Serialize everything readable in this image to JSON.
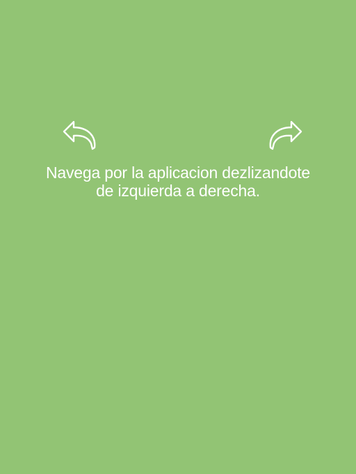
{
  "screen": {
    "background_color": "#92c474",
    "text_color": "#ffffff"
  },
  "arrows": {
    "left_icon": "swipe-left-curved-arrow-icon",
    "right_icon": "swipe-right-curved-arrow-icon"
  },
  "instructions": {
    "line1": "Navega por la aplicacion dezlizandote",
    "line2": "de izquierda a derecha."
  }
}
